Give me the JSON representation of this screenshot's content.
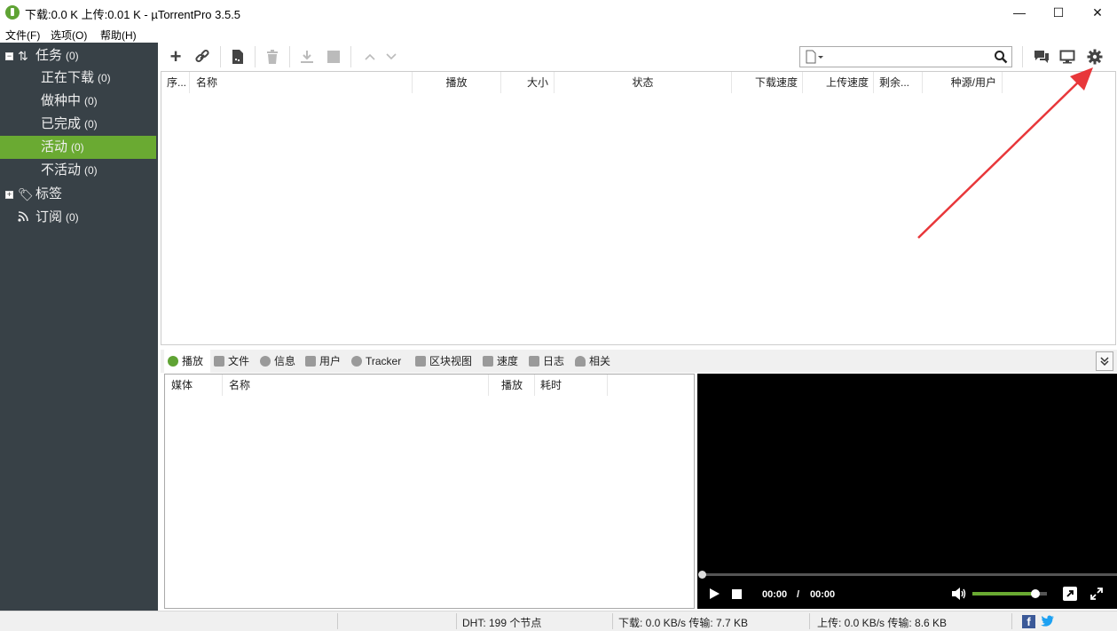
{
  "titlebar": {
    "title": "下载:0.0 K 上传:0.01 K - µTorrentPro 3.5.5",
    "minimize": "—",
    "maximize": "☐",
    "close": "✕"
  },
  "menu": [
    "文件(F)",
    "选项(O)",
    "帮助(H)"
  ],
  "sidebar": {
    "tasks": {
      "label": "任务",
      "count": "(0)"
    },
    "items": [
      {
        "label": "正在下载",
        "count": "(0)"
      },
      {
        "label": "做种中",
        "count": "(0)"
      },
      {
        "label": "已完成",
        "count": "(0)"
      },
      {
        "label": "活动",
        "count": "(0)",
        "active": true
      },
      {
        "label": "不活动",
        "count": "(0)"
      }
    ],
    "labels": {
      "label": "标签"
    },
    "feeds": {
      "label": "订阅",
      "count": "(0)"
    }
  },
  "toolbar": {
    "add_icon": "+",
    "link_icon": "🔗",
    "create_icon": "▚",
    "delete_icon": "🗑",
    "download_icon": "⤓",
    "stop_icon": "■",
    "up_icon": "∧",
    "down_icon": "∨",
    "search_placeholder": ""
  },
  "torrent_columns": [
    "序...",
    "名称",
    "播放",
    "大小",
    "状态",
    "下载速度",
    "上传速度",
    "剩余...",
    "种源/用户"
  ],
  "detail_tabs": [
    "播放",
    "文件",
    "信息",
    "用户",
    "Tracker",
    "区块视图",
    "速度",
    "日志",
    "相关"
  ],
  "media_columns": [
    "媒体",
    "名称",
    "播放",
    "耗时"
  ],
  "player": {
    "time_current": "00:00",
    "time_sep": "/",
    "time_total": "00:00",
    "volume": 0.85
  },
  "status": {
    "dht": "DHT: 199 个节点",
    "download": "下载: 0.0 KB/s 传输: 7.7 KB",
    "upload": "上传: 0.0 KB/s 传输: 8.6 KB"
  },
  "colors": {
    "sidebar_bg": "#384147",
    "active_green": "#6aaa32",
    "arrow_red": "#e8373a"
  }
}
